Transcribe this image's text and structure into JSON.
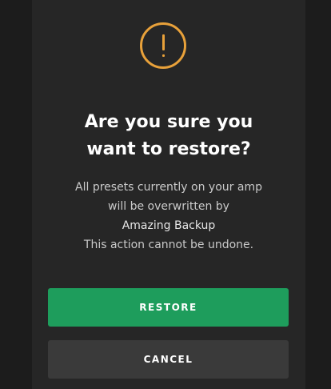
{
  "dialog": {
    "title_line1": "Are you sure you",
    "title_line2": "want to restore?",
    "message": {
      "line1": "All presets currently on your amp",
      "line2": "will be overwritten by",
      "backup_name": "Amazing Backup",
      "line4": "This action cannot be undone."
    },
    "buttons": {
      "restore_label": "RESTORE",
      "cancel_label": "CANCEL"
    },
    "icon": "alert-circle-icon"
  },
  "colors": {
    "accent": "#e8a13a",
    "primary_button": "#1e9d5c",
    "secondary_button": "#3a3a3a",
    "dialog_background": "#262626"
  }
}
